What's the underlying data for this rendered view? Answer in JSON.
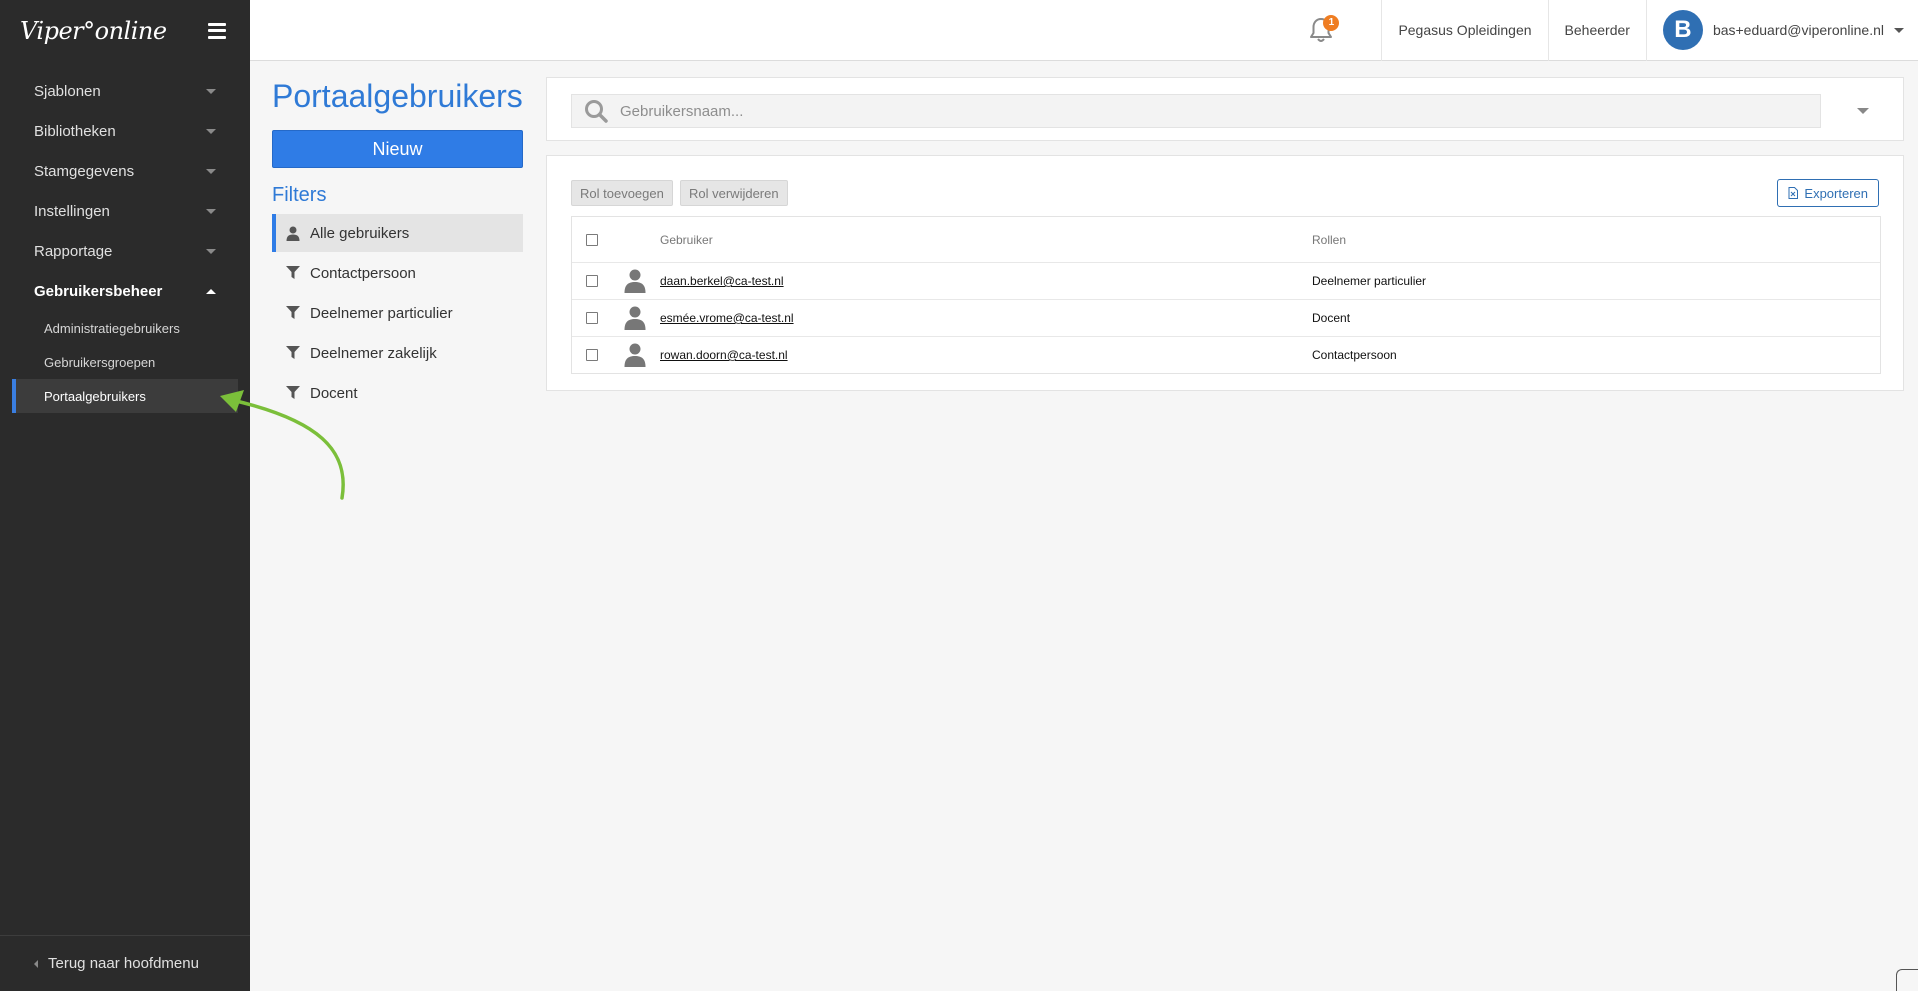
{
  "app": {
    "logo": "Viper°online"
  },
  "sidebar": {
    "items": [
      {
        "label": "Sjablonen"
      },
      {
        "label": "Bibliotheken"
      },
      {
        "label": "Stamgegevens"
      },
      {
        "label": "Instellingen"
      },
      {
        "label": "Rapportage"
      },
      {
        "label": "Gebruikersbeheer"
      }
    ],
    "subitems": [
      {
        "label": "Administratiegebruikers"
      },
      {
        "label": "Gebruikersgroepen"
      },
      {
        "label": "Portaalgebruikers"
      }
    ],
    "footer": "Terug naar hoofdmenu"
  },
  "topbar": {
    "notification_count": "1",
    "organization": "Pegasus Opleidingen",
    "role": "Beheerder",
    "avatar_letter": "B",
    "user_email": "bas+eduard@viperonline.nl"
  },
  "page": {
    "title": "Portaalgebruikers",
    "new_button": "Nieuw",
    "filters_title": "Filters"
  },
  "filters": [
    {
      "label": "Alle gebruikers",
      "icon": "user-icon"
    },
    {
      "label": "Contactpersoon",
      "icon": "filter-icon"
    },
    {
      "label": "Deelnemer particulier",
      "icon": "filter-icon"
    },
    {
      "label": "Deelnemer zakelijk",
      "icon": "filter-icon"
    },
    {
      "label": "Docent",
      "icon": "filter-icon"
    }
  ],
  "search": {
    "placeholder": "Gebruikersnaam..."
  },
  "toolbar": {
    "add_role": "Rol toevoegen",
    "remove_role": "Rol verwijderen",
    "export": "Exporteren"
  },
  "table": {
    "columns": {
      "user": "Gebruiker",
      "roles": "Rollen"
    },
    "rows": [
      {
        "user": "daan.berkel@ca-test.nl",
        "role": "Deelnemer particulier"
      },
      {
        "user": "esmée.vrome@ca-test.nl",
        "role": "Docent"
      },
      {
        "user": "rowan.doorn@ca-test.nl",
        "role": "Contactpersoon"
      }
    ]
  },
  "colors": {
    "accent": "#2f7ce6",
    "sidebar_bg": "#2b2b2b",
    "badge": "#ef7d22",
    "annotation_arrow": "#7bbf3a"
  }
}
